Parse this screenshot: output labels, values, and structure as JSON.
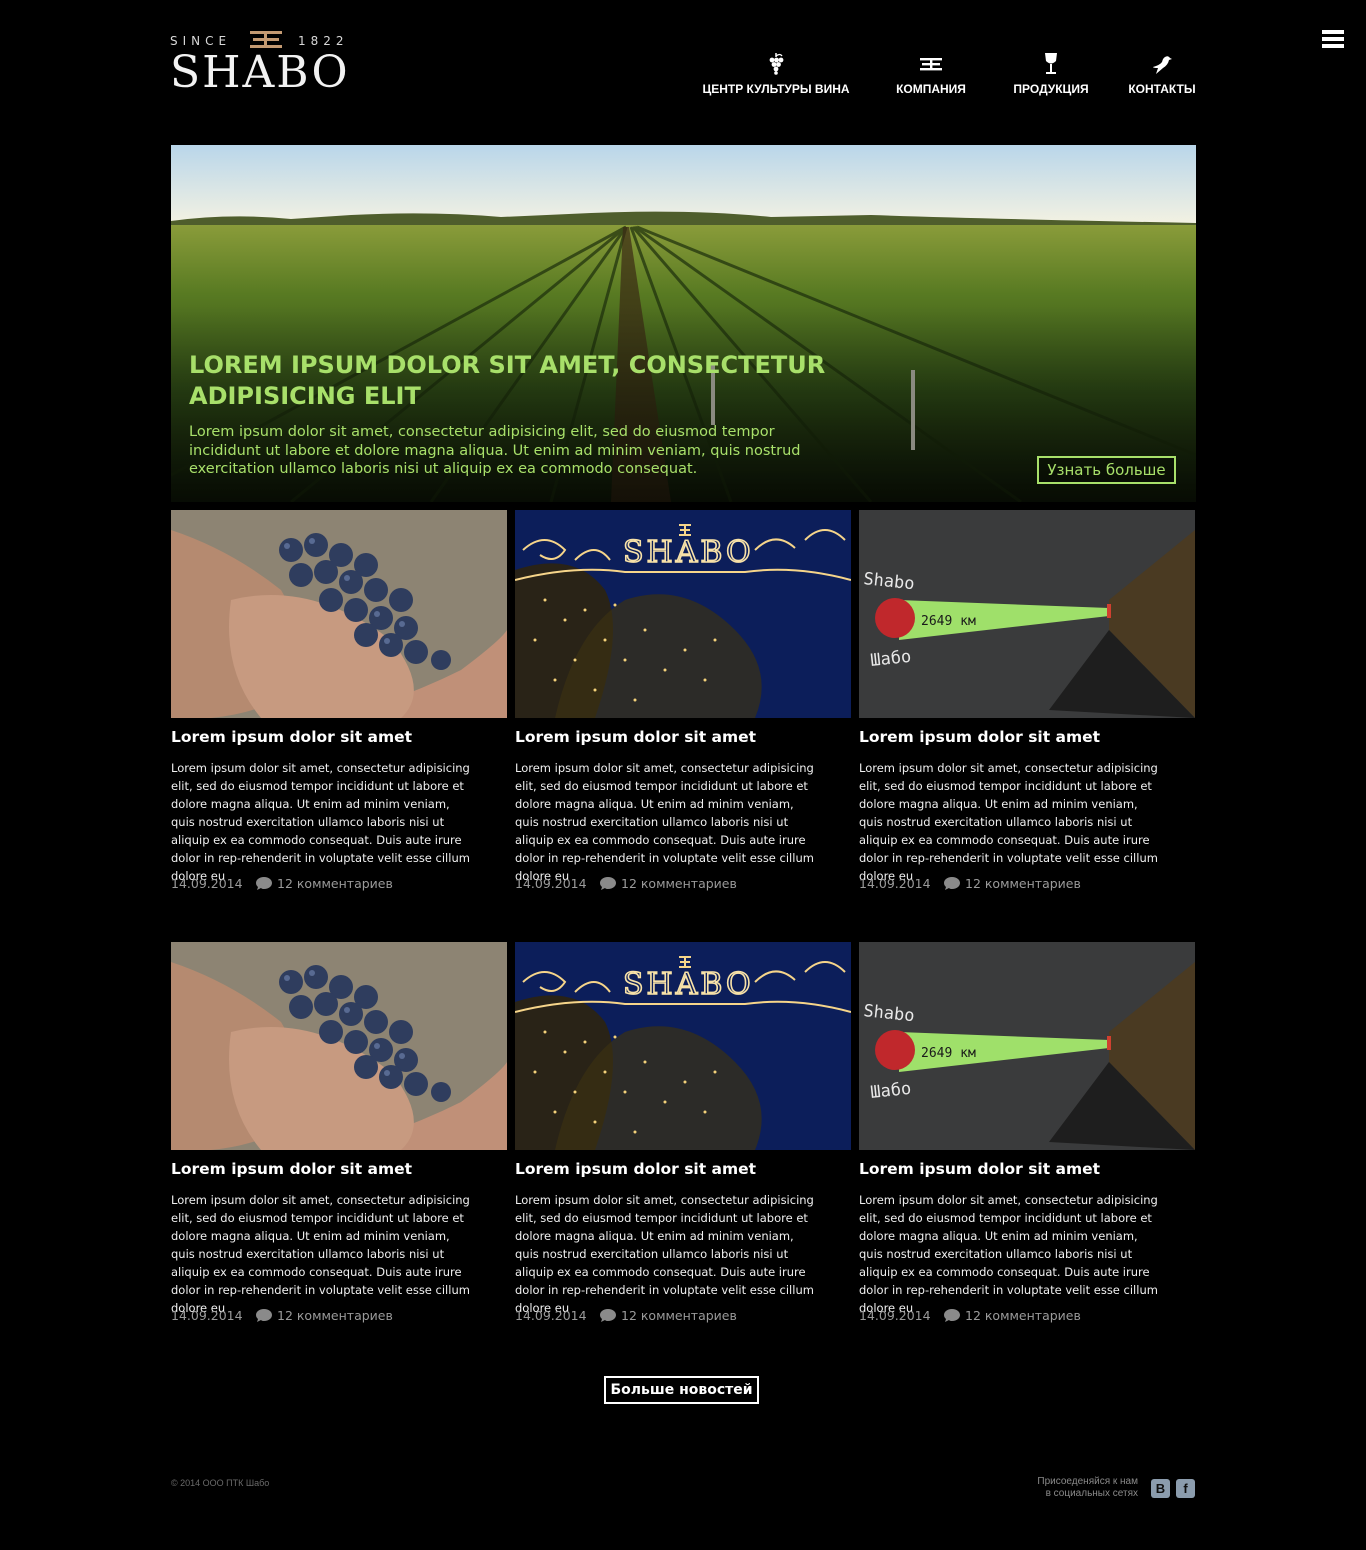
{
  "header": {
    "logo_since": "SINCE",
    "logo_year": "1822",
    "logo_name": "SHABO",
    "nav": [
      {
        "label": "ЦЕНТР КУЛЬТУРЫ ВИНА",
        "icon": "grapes-icon"
      },
      {
        "label": "КОМПАНИЯ",
        "icon": "shabo-mark-icon"
      },
      {
        "label": "ПРОДУКЦИЯ",
        "icon": "wine-glass-icon"
      },
      {
        "label": "КОНТАКТЫ",
        "icon": "bird-icon"
      }
    ],
    "menu_icon": "hamburger-menu-icon"
  },
  "hero": {
    "title": "LOREM IPSUM DOLOR SIT AMET, CONSECTETUR ADIPISICING ELIT",
    "text": "Lorem ipsum dolor sit amet, consectetur adipisicing elit, sed do eiusmod tempor incididunt ut labore et dolore magna aliqua. Ut enim ad minim veniam, quis nostrud exercitation ullamco laboris nisi ut aliquip ex ea commodo consequat.",
    "button": "Узнать больше",
    "accent_color": "#a8e06a"
  },
  "news": [
    {
      "image": "grapes-in-hands",
      "title": "Lorem ipsum dolor sit amet",
      "text": "Lorem ipsum dolor sit amet, consectetur adipisicing elit, sed do eiusmod tempor incididunt ut labore et dolore magna aliqua. Ut enim ad minim veniam, quis nostrud exercitation ullamco laboris nisi ut aliquip ex ea commodo consequat. Duis aute irure dolor in rep-rehenderit in voluptate velit esse cillum dolore eu",
      "date": "14.09.2014",
      "comments": "12 комментариев"
    },
    {
      "image": "shabo-illuminated-sign",
      "title": "Lorem ipsum dolor sit amet",
      "text": "Lorem ipsum dolor sit amet, consectetur adipisicing elit, sed do eiusmod tempor incididunt ut labore et dolore magna aliqua. Ut enim ad minim veniam, quis nostrud exercitation ullamco laboris nisi ut aliquip ex ea commodo consequat. Duis aute irure dolor in rep-rehenderit in voluptate velit esse cillum dolore eu",
      "date": "14.09.2014",
      "comments": "12 комментариев"
    },
    {
      "image": "shabo-distance-wall",
      "title": "Lorem ipsum dolor sit amet",
      "text": "Lorem ipsum dolor sit amet, consectetur adipisicing elit, sed do eiusmod tempor incididunt ut labore et dolore magna aliqua. Ut enim ad minim veniam, quis nostrud exercitation ullamco laboris nisi ut aliquip ex ea commodo consequat. Duis aute irure dolor in rep-rehenderit in voluptate velit esse cillum dolore eu",
      "date": "14.09.2014",
      "comments": "12 комментариев"
    },
    {
      "image": "grapes-in-hands",
      "title": "Lorem ipsum dolor sit amet",
      "text": "Lorem ipsum dolor sit amet, consectetur adipisicing elit, sed do eiusmod tempor incididunt ut labore et dolore magna aliqua. Ut enim ad minim veniam, quis nostrud exercitation ullamco laboris nisi ut aliquip ex ea commodo consequat. Duis aute irure dolor in rep-rehenderit in voluptate velit esse cillum dolore eu",
      "date": "14.09.2014",
      "comments": "12 комментариев"
    },
    {
      "image": "shabo-illuminated-sign",
      "title": "Lorem ipsum dolor sit amet",
      "text": "Lorem ipsum dolor sit amet, consectetur adipisicing elit, sed do eiusmod tempor incididunt ut labore et dolore magna aliqua. Ut enim ad minim veniam, quis nostrud exercitation ullamco laboris nisi ut aliquip ex ea commodo consequat. Duis aute irure dolor in rep-rehenderit in voluptate velit esse cillum dolore eu",
      "date": "14.09.2014",
      "comments": "12 комментариев"
    },
    {
      "image": "shabo-distance-wall",
      "title": "Lorem ipsum dolor sit amet",
      "text": "Lorem ipsum dolor sit amet, consectetur adipisicing elit, sed do eiusmod tempor incididunt ut labore et dolore magna aliqua. Ut enim ad minim veniam, quis nostrud exercitation ullamco laboris nisi ut aliquip ex ea commodo consequat. Duis aute irure dolor in rep-rehenderit in voluptate velit esse cillum dolore eu",
      "date": "14.09.2014",
      "comments": "12 комментариев"
    }
  ],
  "photo_text": {
    "sign": "SHABO",
    "wall_latin": "Shabo",
    "wall_distance": "2649 км",
    "wall_cyrillic": "Шабо"
  },
  "more_button": "Больше новостей",
  "footer": {
    "copyright": "© 2014 ООО ПТК Шабо",
    "social_line1": "Присоеденяйся к нам",
    "social_line2": "в социальных сетях",
    "vk_label": "В",
    "fb_label": "f"
  }
}
